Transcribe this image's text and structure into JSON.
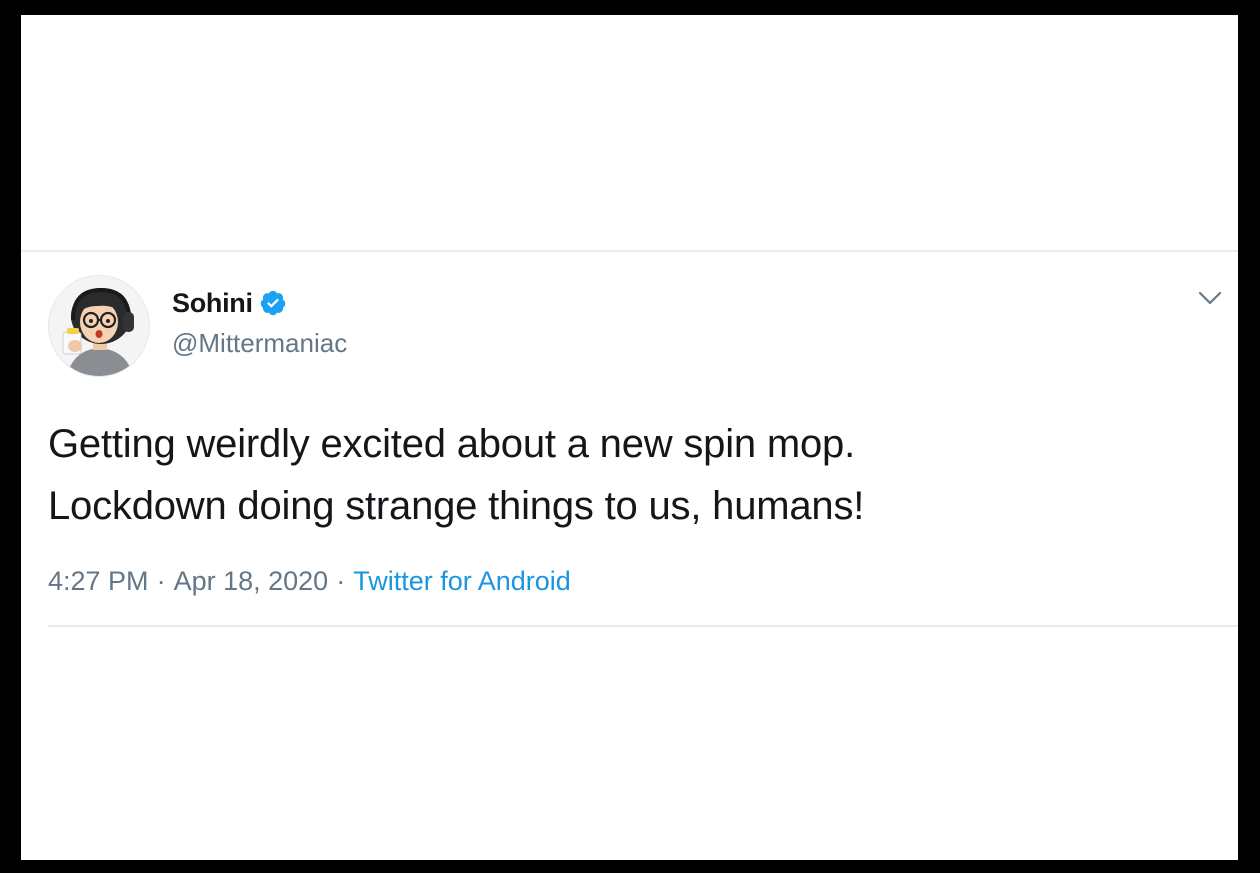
{
  "tweet": {
    "author": {
      "display_name": "Sohini",
      "handle": "@Mittermaniac",
      "verified": true,
      "avatar_icon": "cartoon-avatar"
    },
    "text_lines": [
      "Getting weirdly excited about a new spin mop.",
      "Lockdown doing strange things to us, humans!"
    ],
    "time": "4:27 PM",
    "separator": "·",
    "date": "Apr 18, 2020",
    "source": "Twitter for Android",
    "menu_icon": "chevron-down-icon"
  },
  "colors": {
    "text_primary": "#14171a",
    "text_secondary": "#657786",
    "link": "#1b95e0",
    "verified_badge": "#1da1f2",
    "divider": "#e6ecf0"
  }
}
